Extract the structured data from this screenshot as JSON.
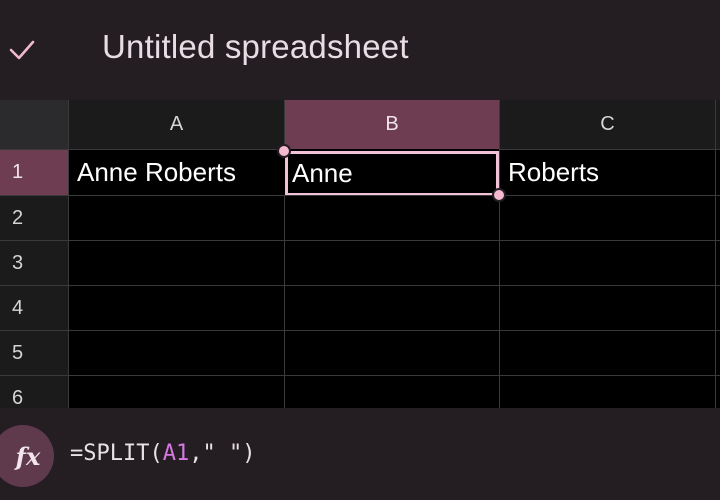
{
  "header": {
    "title": "Untitled spreadsheet",
    "confirm_icon": "checkmark-icon"
  },
  "columns": [
    "A",
    "B",
    "C"
  ],
  "rows": [
    "1",
    "2",
    "3",
    "4",
    "5",
    "6"
  ],
  "cells": {
    "A1": "Anne Roberts",
    "B1": "Anne",
    "C1": "Roberts"
  },
  "selection": {
    "active_cell": "B1",
    "column": "B",
    "row": "1"
  },
  "formula_bar": {
    "icon": "fx-icon",
    "fx_label": "fx",
    "prefix": "=SPLIT(",
    "ref": "A1",
    "suffix": ",\" \")"
  },
  "colors": {
    "accent": "#6e3d52",
    "selection_border": "#f2c3d6",
    "handle": "#f5b9cf",
    "reference": "#d677e3",
    "background": "#241d22"
  }
}
